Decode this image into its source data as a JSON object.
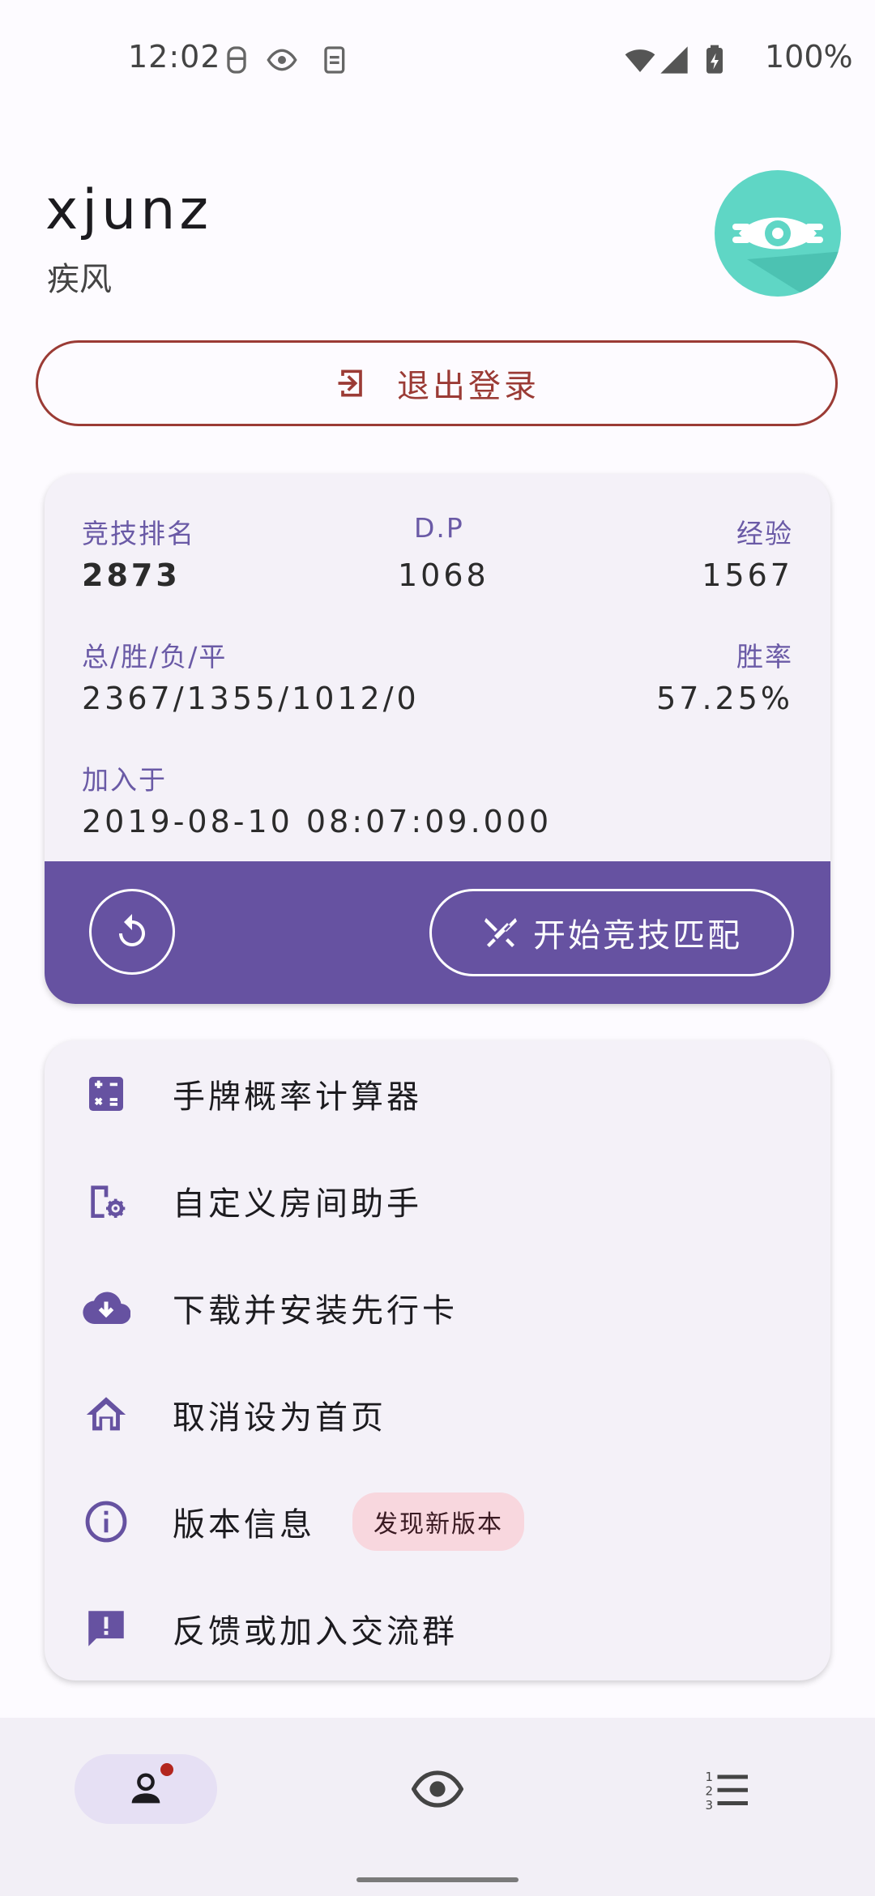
{
  "status_bar": {
    "time": "12:02",
    "battery": "100%"
  },
  "profile": {
    "username": "xjunz",
    "subtitle": "疾风"
  },
  "logout": {
    "label": "退出登录"
  },
  "stats": {
    "rank_label": "竞技排名",
    "rank_value": "2873",
    "dp_label": "D.P",
    "dp_value": "1068",
    "exp_label": "经验",
    "exp_value": "1567",
    "record_label": "总/胜/负/平",
    "record_value": "2367/1355/1012/0",
    "winrate_label": "胜率",
    "winrate_value": "57.25%",
    "joined_label": "加入于",
    "joined_value": "2019-08-10 08:07:09.000"
  },
  "actions": {
    "match_label": "开始竞技匹配"
  },
  "menu": {
    "items": [
      {
        "label": "手牌概率计算器",
        "icon": "calculator-icon"
      },
      {
        "label": "自定义房间助手",
        "icon": "room-settings-icon"
      },
      {
        "label": "下载并安装先行卡",
        "icon": "cloud-download-icon"
      },
      {
        "label": "取消设为首页",
        "icon": "home-icon"
      },
      {
        "label": "版本信息",
        "icon": "info-icon",
        "badge": "发现新版本"
      },
      {
        "label": "反馈或加入交流群",
        "icon": "feedback-icon"
      }
    ]
  },
  "colors": {
    "accent": "#6652a1",
    "logout": "#9b3b35",
    "avatar": "#5fd6c5",
    "badge": "#f8d7de"
  }
}
